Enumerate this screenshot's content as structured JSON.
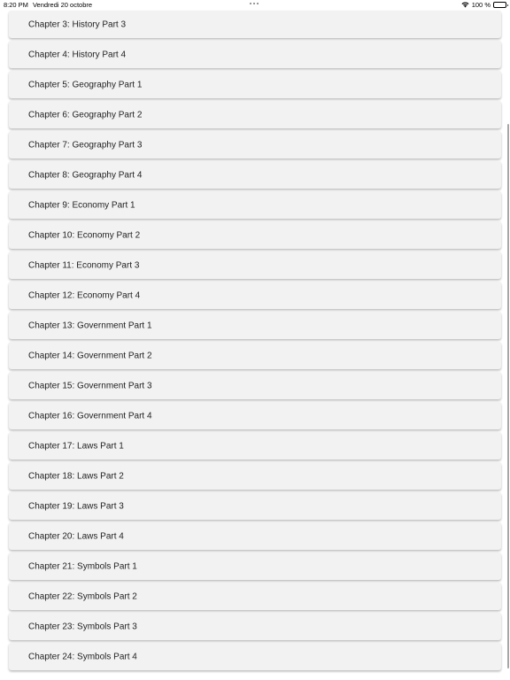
{
  "status_bar": {
    "time": "8:20 PM",
    "date": "Vendredi 20 octobre",
    "battery_text": "100 %",
    "icons": [
      "multitasking-dots-icon",
      "wifi-icon",
      "battery-icon"
    ]
  },
  "chapters": [
    "Chapter 3: History Part 3",
    "Chapter 4: History Part 4",
    "Chapter 5: Geography Part 1",
    "Chapter 6: Geography Part 2",
    "Chapter 7: Geography Part 3",
    "Chapter 8: Geography Part 4",
    "Chapter 9: Economy Part 1",
    "Chapter 10: Economy Part 2",
    "Chapter 11: Economy Part 3",
    "Chapter 12: Economy Part 4",
    "Chapter 13: Government Part 1",
    "Chapter 14: Government Part 2",
    "Chapter 15: Government Part 3",
    "Chapter 16: Government Part 4",
    "Chapter 17: Laws Part 1",
    "Chapter 18: Laws Part 2",
    "Chapter 19: Laws Part 3",
    "Chapter 20: Laws Part 4",
    "Chapter 21: Symbols Part 1",
    "Chapter 22: Symbols Part 2",
    "Chapter 23: Symbols Part 3",
    "Chapter 24: Symbols Part 4"
  ],
  "colors": {
    "item_background": "#f2f2f2",
    "page_background": "#ffffff",
    "text": "#222222"
  }
}
